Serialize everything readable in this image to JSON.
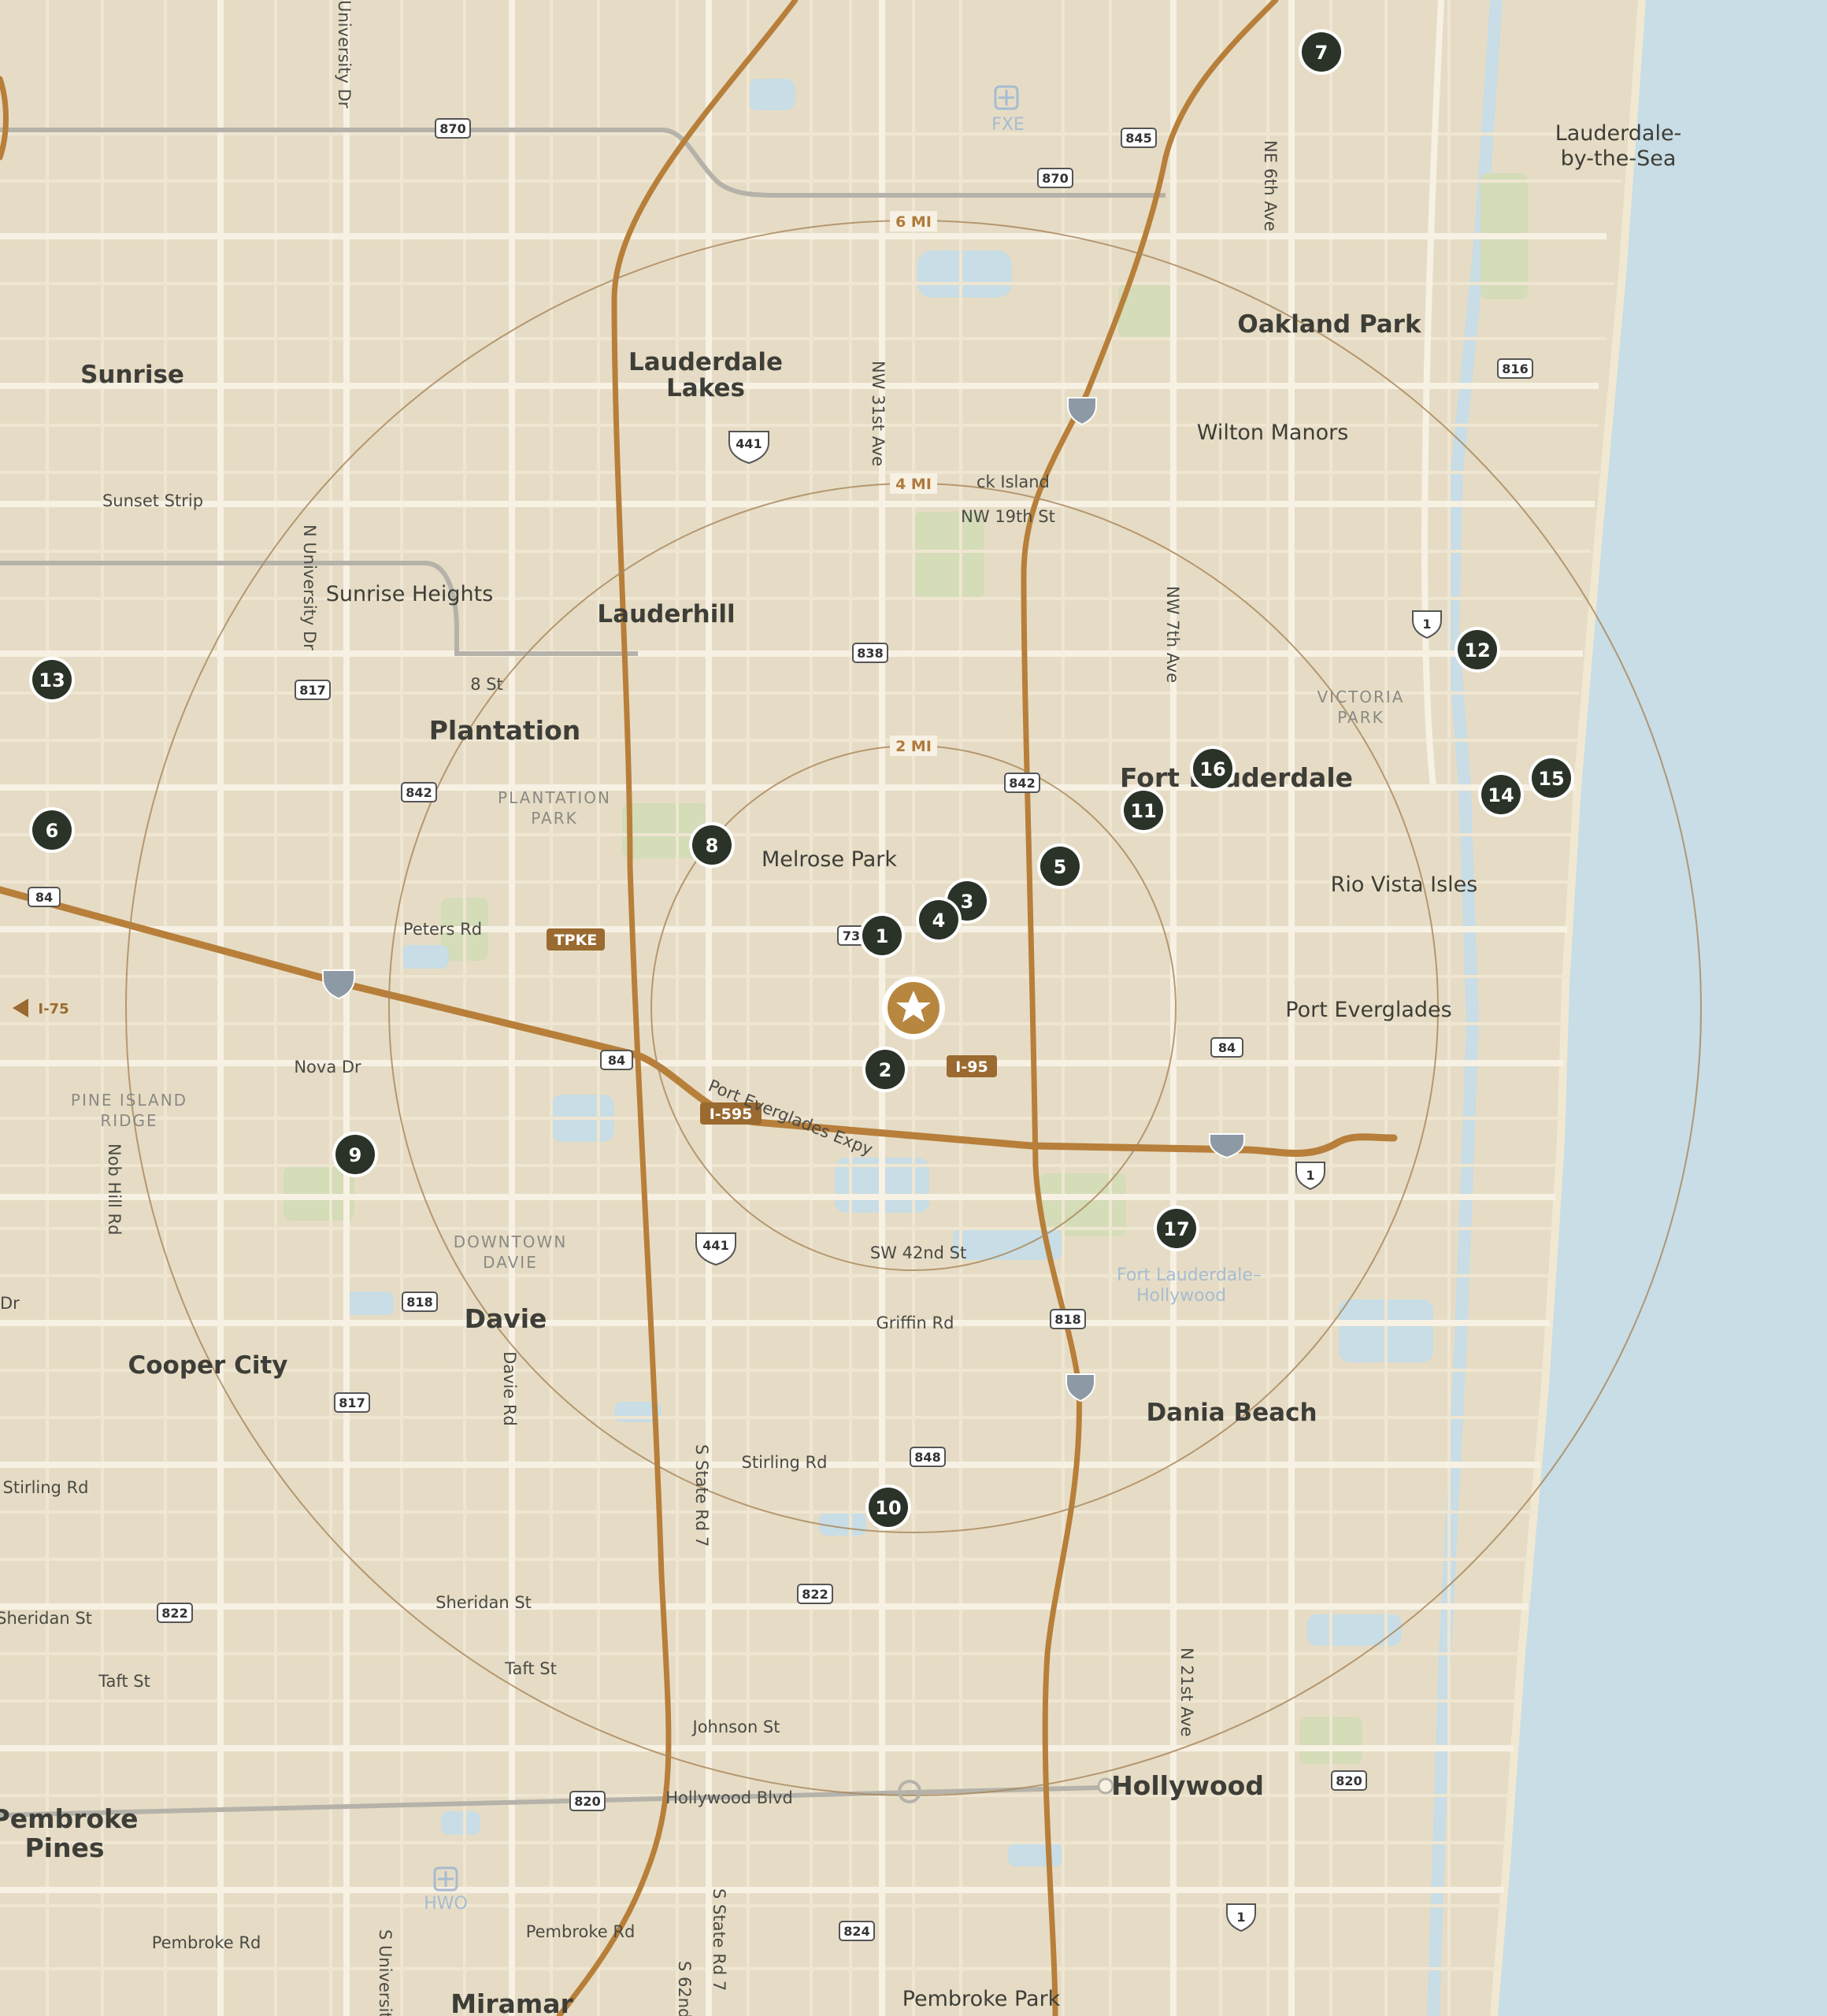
{
  "map": {
    "colors": {
      "land": "#e6dcc5",
      "water": "#c8dde5",
      "park": "#d4dcb8",
      "road_minor": "#f3ecdd",
      "road_major": "#f8f3e8",
      "highway": "#b77f3a",
      "expressway_gray": "#b5b2aa",
      "ring": "#a8865a",
      "marker_fill": "#2b3328",
      "subject_fill": "#b8873f",
      "label": "#3e3e38"
    },
    "subject": {
      "icon": "star-icon"
    },
    "rings": [
      {
        "label": "2 MI"
      },
      {
        "label": "4 MI"
      },
      {
        "label": "6 MI"
      }
    ],
    "markers": [
      {
        "number": "1"
      },
      {
        "number": "2"
      },
      {
        "number": "3"
      },
      {
        "number": "4"
      },
      {
        "number": "5"
      },
      {
        "number": "6"
      },
      {
        "number": "7"
      },
      {
        "number": "8"
      },
      {
        "number": "9"
      },
      {
        "number": "10"
      },
      {
        "number": "11"
      },
      {
        "number": "12"
      },
      {
        "number": "13"
      },
      {
        "number": "14"
      },
      {
        "number": "15"
      },
      {
        "number": "16"
      },
      {
        "number": "17"
      }
    ],
    "places": {
      "sunrise": "Sunrise",
      "lauderdale_lakes_1": "Lauderdale",
      "lauderdale_lakes_2": "Lakes",
      "oakland_park": "Oakland Park",
      "lbts_1": "Lauderdale-",
      "lbts_2": "by-the-Sea",
      "wilton_manors": "Wilton Manors",
      "lauderhill": "Lauderhill",
      "plantation": "Plantation",
      "fort_lauderdale": "Fort Lauderdale",
      "melrose_park": "Melrose Park",
      "rio_vista": "Rio Vista Isles",
      "port_everglades": "Port Everglades",
      "davie": "Davie",
      "cooper_city": "Cooper City",
      "dania_beach": "Dania Beach",
      "hollywood": "Hollywood",
      "pembroke_pines_1": "Pembroke",
      "pembroke_pines_2": "Pines",
      "miramar": "Miramar",
      "pembroke_park": "Pembroke Park",
      "sunrise_heights": "Sunrise Heights",
      "sunset_strip": "Sunset Strip",
      "city_island": "ck Island"
    },
    "districts": {
      "plantation_park_1": "PLANTATION",
      "plantation_park_2": "PARK",
      "pine_island_1": "PINE ISLAND",
      "pine_island_2": "RIDGE",
      "downtown_davie_1": "DOWNTOWN",
      "downtown_davie_2": "DAVIE",
      "victoria_1": "VICTORIA",
      "victoria_2": "PARK"
    },
    "pois": {
      "fxe": "FXE",
      "hwo": "HWO",
      "fll_1": "Fort Lauderdale–",
      "fll_2": "Hollywood"
    },
    "streets": {
      "nw31": "NW 31st Ave",
      "nw19": "NW 19th St",
      "nw7": "NW 7th Ave",
      "ne6": "NE 6th Ave",
      "univ_top": "University Dr",
      "n_univ": "N University Dr",
      "s_univ": "S Universit",
      "st8": "8 St",
      "peters": "Peters Rd",
      "nova": "Nova Dr",
      "nob_hill": "Nob Hill Rd",
      "davie_rd": "Davie Rd",
      "sw42": "SW 42nd St",
      "griffin": "Griffin Rd",
      "stirling": "Stirling Rd",
      "stirling2": "Stirling Rd",
      "sheridan": "Sheridan St",
      "sheridan2": "Sheridan St",
      "taft": "Taft St",
      "taft2": "Taft St",
      "johnson": "Johnson St",
      "hollywood_blvd": "Hollywood Blvd",
      "pembroke_rd": "Pembroke Rd",
      "pembroke_rd2": "Pembroke Rd",
      "s_state_7": "S State Rd 7",
      "s_state_7b": "S State Rd 7",
      "s62": "S 62nd",
      "n21": "N 21st Ave",
      "dr": "Dr",
      "everglades_expy": "Port Everglades Expy"
    },
    "shields": {
      "s870a": "870",
      "s870b": "870",
      "s845": "845",
      "s816": "816",
      "s441a": "441",
      "s441b": "441",
      "s838": "838",
      "s817a": "817",
      "s817b": "817",
      "s842a": "842",
      "s842b": "842",
      "s84a": "84",
      "s84b": "84",
      "s84c": "84",
      "s818a": "818",
      "s818b": "818",
      "s848": "848",
      "s822a": "822",
      "s822b": "822",
      "s820a": "820",
      "s820b": "820",
      "s824": "824",
      "s1a": "1",
      "s1b": "1",
      "s1c": "1",
      "s73": "73"
    },
    "highway_tags": {
      "tpke": "TPKE",
      "i95": "I-95",
      "i595": "I-595",
      "i75": "I-75"
    }
  }
}
